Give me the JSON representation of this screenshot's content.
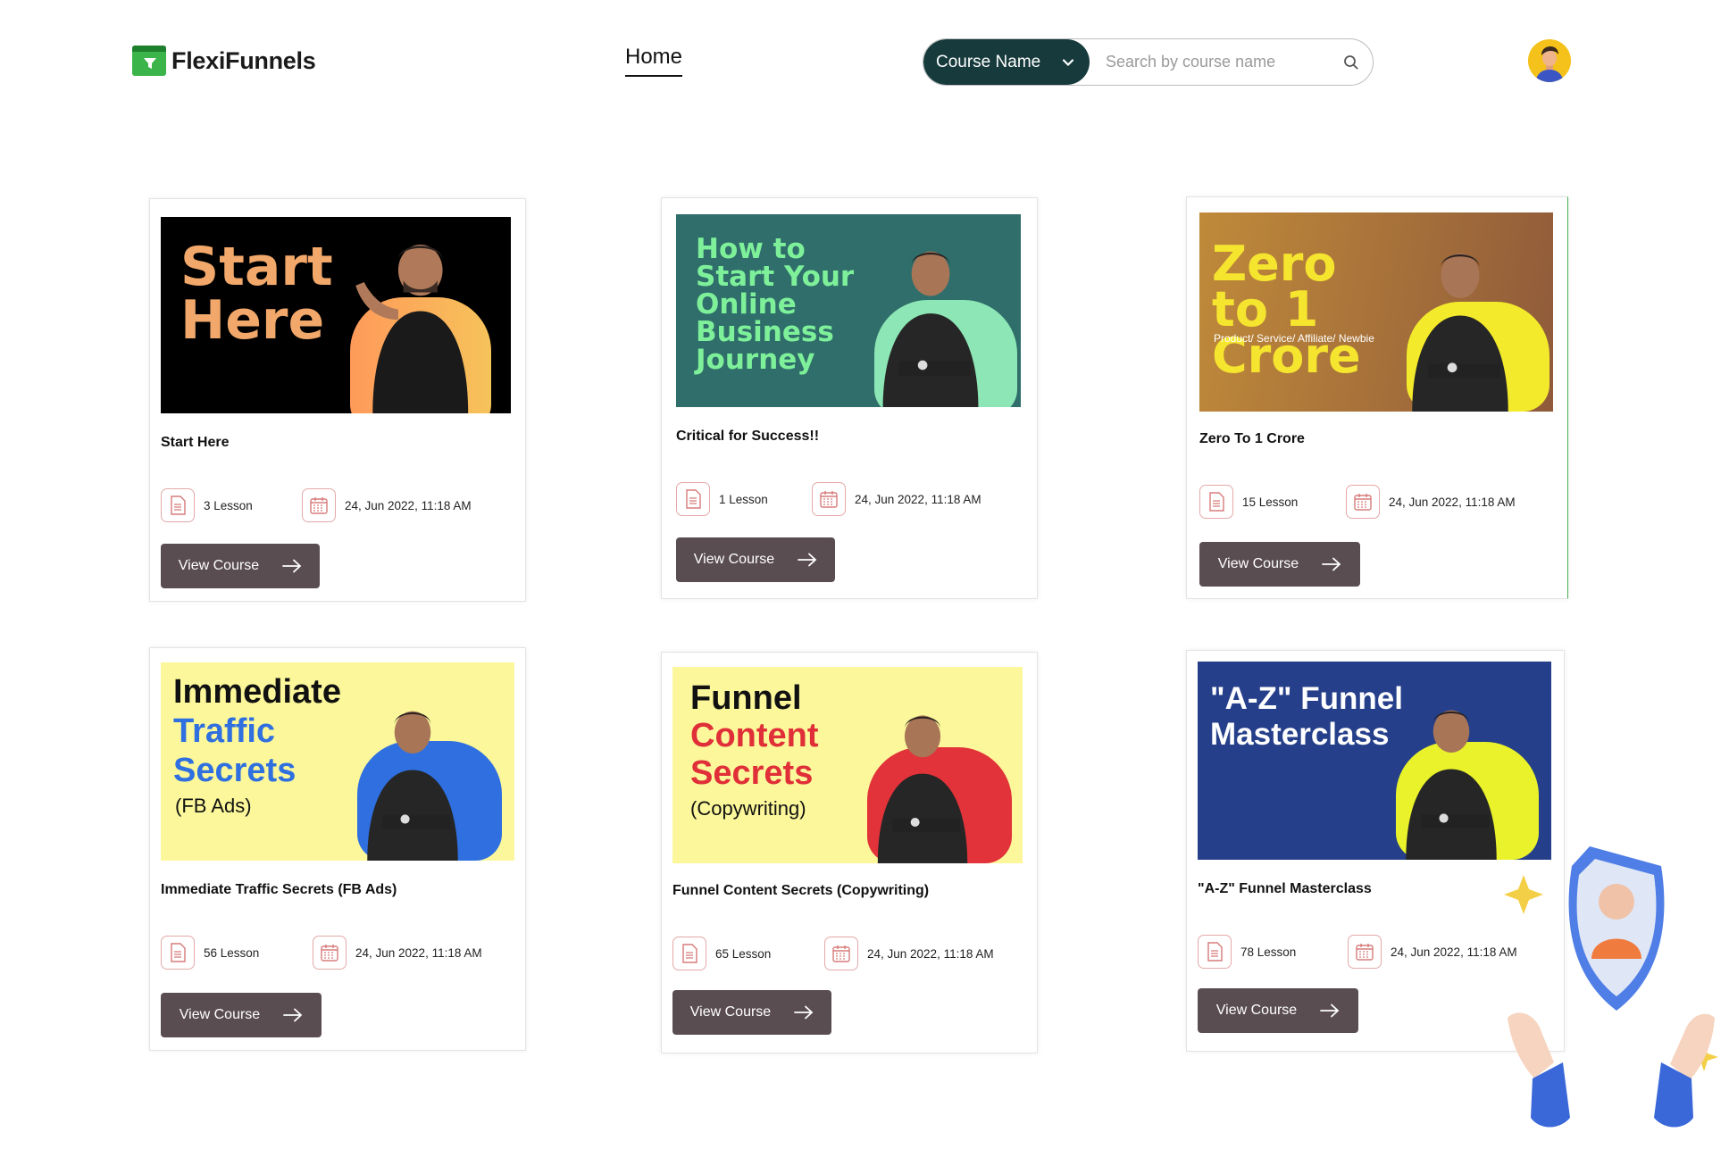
{
  "brand": {
    "name": "FlexiFunnels"
  },
  "nav": {
    "home": "Home"
  },
  "search": {
    "select_label": "Course Name",
    "placeholder": "Search by course name"
  },
  "courses": [
    {
      "thumb_title": "Start Here",
      "title": "Start Here",
      "lessons": "3 Lesson",
      "date": "24, Jun 2022, 11:18 AM",
      "button": "View Course"
    },
    {
      "thumb_title": "How to Start Your Online Business Journey",
      "title": "Critical for Success!!",
      "lessons": "1 Lesson",
      "date": "24, Jun 2022, 11:18 AM",
      "button": "View Course"
    },
    {
      "thumb_title": "Zero to 1 Crore",
      "thumb_sub": "Product/ Service/ Affiliate/ Newbie",
      "title": "Zero To 1 Crore",
      "lessons": "15 Lesson",
      "date": "24, Jun 2022, 11:18 AM",
      "button": "View Course"
    },
    {
      "thumb_title_1": "Immediate",
      "thumb_title_2": "Traffic",
      "thumb_title_3": "Secrets",
      "thumb_sub": "(FB Ads)",
      "title": "Immediate Traffic Secrets (FB Ads)",
      "lessons": "56 Lesson",
      "date": "24, Jun 2022, 11:18 AM",
      "button": "View Course"
    },
    {
      "thumb_title_1": "Funnel",
      "thumb_title_2": "Content",
      "thumb_title_3": "Secrets",
      "thumb_sub": "(Copywriting)",
      "title": "Funnel Content Secrets (Copywriting)",
      "lessons": "65 Lesson",
      "date": "24, Jun 2022, 11:18 AM",
      "button": "View Course"
    },
    {
      "thumb_title": "\"A-Z\" Funnel Masterclass",
      "title": "\"A-Z\" Funnel Masterclass",
      "lessons": "78 Lesson",
      "date": "24, Jun 2022, 11:18 AM",
      "button": "View Course"
    }
  ],
  "colors": {
    "primary_dark": "#173a3c",
    "button": "#5a4d51",
    "thumb_1": "#000000",
    "thumb_2": "#2f6e6a",
    "thumb_3": "#a9783a",
    "thumb_4": "#fbf79a",
    "thumb_5": "#fbf79a",
    "thumb_6": "#253f8a"
  }
}
